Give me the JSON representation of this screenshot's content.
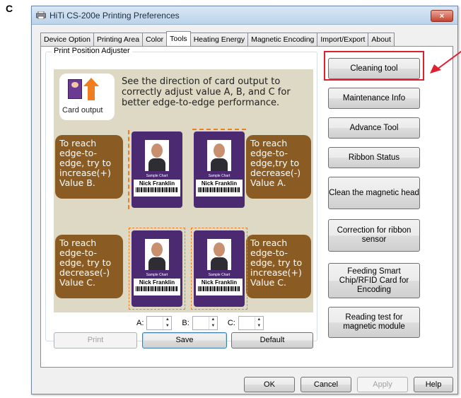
{
  "figure_letter": "C",
  "window": {
    "title": "HiTi CS-200e Printing Preferences",
    "close_label": "×"
  },
  "tabs": [
    {
      "label": "Device Option",
      "active": false
    },
    {
      "label": "Printing Area",
      "active": false
    },
    {
      "label": "Color",
      "active": false
    },
    {
      "label": "Tools",
      "active": true
    },
    {
      "label": "Heating Energy",
      "active": false
    },
    {
      "label": "Magnetic Encoding",
      "active": false
    },
    {
      "label": "Import/Export",
      "active": false
    },
    {
      "label": "About",
      "active": false
    }
  ],
  "print_position": {
    "group_label": "Print Position Adjuster",
    "card_output_label": "Card output",
    "description": "See the direction of card output to correctly adjust value A, B, and C for better edge-to-edge performance.",
    "bubbles": {
      "top_left": "To reach edge-to-edge, try to increase(+) Value B.",
      "top_right": "To reach edge-to-edge,try to decrease(-) Value A.",
      "bottom_left": "To reach edge-to-edge, try to decrease(-) Value C.",
      "bottom_right": "To reach edge-to-edge, try to increase(+) Value C."
    },
    "card": {
      "sample_label": "Sample Chart",
      "name": "Nick Franklin",
      "barcode_number": "13164786445646"
    },
    "fields": {
      "a_label": "A:",
      "b_label": "B:",
      "c_label": "C:",
      "a_value": "",
      "b_value": "",
      "c_value": ""
    },
    "print_button": "Print",
    "save_button": "Save",
    "default_button": "Default"
  },
  "tools_buttons": [
    "Cleaning tool",
    "Maintenance Info",
    "Advance Tool",
    "Ribbon Status",
    "Clean the magnetic head",
    "Correction for ribbon sensor",
    "Feeding Smart Chip/RFID Card for Encoding",
    "Reading test for magnetic module"
  ],
  "footer": {
    "ok": "OK",
    "cancel": "Cancel",
    "apply": "Apply",
    "help": "Help"
  },
  "colors": {
    "highlight": "#e02030",
    "bubble": "#8a5b22",
    "card": "#4b2a72",
    "dash": "#f07d1e"
  }
}
